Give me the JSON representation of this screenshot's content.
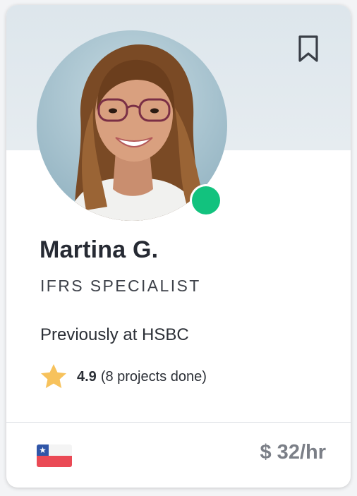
{
  "card": {
    "name": "Martina G.",
    "role": "IFRS SPECIALIST",
    "previous": "Previously at HSBC",
    "rating": {
      "score": "4.9",
      "projects": "(8 projects done)"
    },
    "rate": "$ 32/hr",
    "status": "online",
    "country_flag": "chile-flag-icon"
  },
  "colors": {
    "online": "#12c27e",
    "star": "#f7c25c",
    "rate": "#7b7f87",
    "banner": "#e3e9ed"
  },
  "icons": {
    "bookmark": "bookmark-icon",
    "star": "star-icon",
    "flag": "chile-flag-icon"
  }
}
